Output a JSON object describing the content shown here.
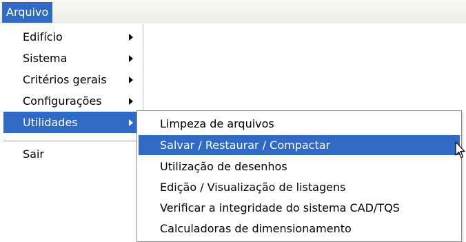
{
  "menubar": {
    "active_menu": "Arquivo"
  },
  "dropdown": {
    "items": [
      {
        "label": "Edifício",
        "has_submenu": true
      },
      {
        "label": "Sistema",
        "has_submenu": true
      },
      {
        "label": "Critérios gerais",
        "has_submenu": true
      },
      {
        "label": "Configurações",
        "has_submenu": true
      },
      {
        "label": "Utilidades",
        "has_submenu": true,
        "highlighted": true
      },
      {
        "label": "Sair",
        "has_submenu": false
      }
    ]
  },
  "submenu": {
    "items": [
      {
        "label": "Limpeza de arquivos"
      },
      {
        "label": "Salvar / Restaurar / Compactar",
        "highlighted": true
      },
      {
        "label": "Utilização de desenhos"
      },
      {
        "label": "Edição / Visualização de listagens"
      },
      {
        "label": "Verificar a integridade do sistema CAD/TQS"
      },
      {
        "label": "Calculadoras de dimensionamento"
      }
    ]
  },
  "colors": {
    "highlight": "#316ac5",
    "highlight_text": "#ffffff",
    "menu_text": "#000000"
  },
  "icons": {
    "submenu_arrow": "chevron-right-icon",
    "cursor": "mouse-pointer-icon"
  }
}
